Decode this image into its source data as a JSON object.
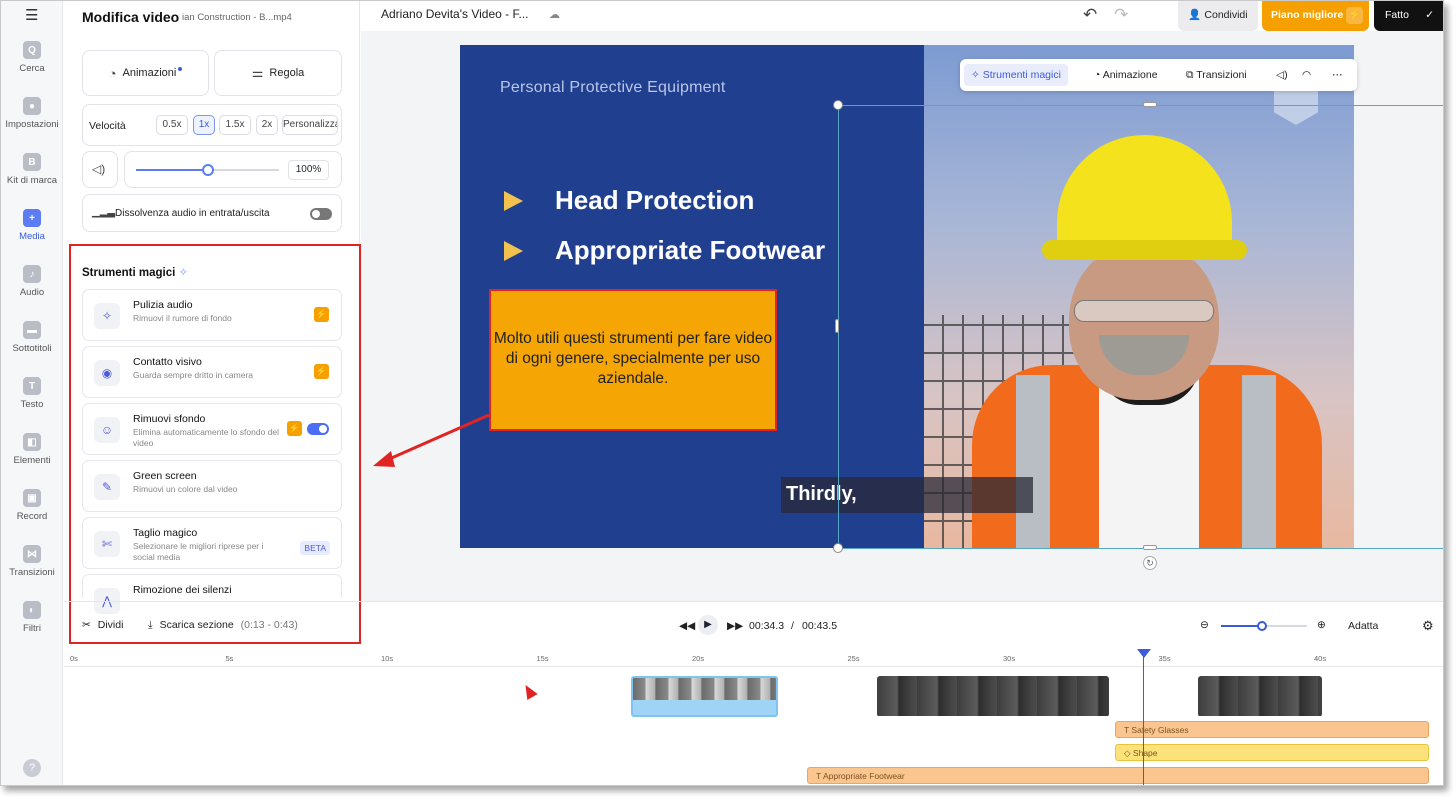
{
  "sidebar": {
    "menu_icon": "hamburger-icon",
    "items": [
      {
        "label": "Cerca",
        "icon": "search-icon",
        "glyph": "Q"
      },
      {
        "label": "Impostazioni",
        "icon": "settings-icon",
        "glyph": "●"
      },
      {
        "label": "Kit di marca",
        "icon": "brand-kit-icon",
        "glyph": "B"
      },
      {
        "label": "Media",
        "icon": "media-plus-icon",
        "glyph": "+"
      },
      {
        "label": "Audio",
        "icon": "music-icon",
        "glyph": "♪"
      },
      {
        "label": "Sottotitoli",
        "icon": "subtitles-icon",
        "glyph": "▬"
      },
      {
        "label": "Testo",
        "icon": "text-icon",
        "glyph": "T"
      },
      {
        "label": "Elementi",
        "icon": "elements-icon",
        "glyph": "◧"
      },
      {
        "label": "Record",
        "icon": "record-icon",
        "glyph": "▣"
      },
      {
        "label": "Transizioni",
        "icon": "transitions-icon",
        "glyph": "⋈"
      },
      {
        "label": "Filtri",
        "icon": "filters-icon",
        "glyph": "◐"
      }
    ],
    "help": "?"
  },
  "panel": {
    "title": "Modifica video",
    "file": "ian Construction - B...mp4",
    "animations_label": "Animazioni",
    "adjust_label": "Regola",
    "speed_label": "Velocità",
    "speed_options": [
      "0.5x",
      "1x",
      "1.5x",
      "2x",
      "Personalizza"
    ],
    "speed_selected": "1x",
    "volume_value": "100%",
    "volume_level": 0.5,
    "fade_label": "Dissolvenza audio in entrata/uscita",
    "fade_on": false,
    "magic_title": "Strumenti magici",
    "tools": [
      {
        "name": "Pulizia audio",
        "desc": "Rimuovi il rumore di fondo",
        "icon": "sparkle-icon",
        "premium": true
      },
      {
        "name": "Contatto visivo",
        "desc": "Guarda sempre dritto in camera",
        "icon": "eye-icon",
        "premium": true
      },
      {
        "name": "Rimuovi sfondo",
        "desc": "Elimina automaticamente lo sfondo del video",
        "icon": "person-bg-icon",
        "premium": true,
        "toggle_on": true
      },
      {
        "name": "Green screen",
        "desc": "Rimuovi un colore dal video",
        "icon": "eyedropper-icon"
      },
      {
        "name": "Taglio magico",
        "desc": "Selezionare le migliori riprese per i social media",
        "icon": "magic-cut-icon",
        "badge": "BETA"
      },
      {
        "name": "Rimozione dei silenzi",
        "desc": "",
        "icon": "silence-icon"
      }
    ],
    "split_label": "Dividi",
    "download_label": "Scarica sezione",
    "download_range": "(0:13 - 0:43)"
  },
  "header": {
    "video_title": "Adriano Devita's Video - F...",
    "share_label": "Condividi",
    "plan_label": "Piano migliore",
    "done_label": "Fatto"
  },
  "slide": {
    "heading": "Personal Protective Equipment",
    "bullets": [
      "Head Protection",
      "Appropriate Footwear"
    ],
    "caption": "Thirdly,"
  },
  "floating_toolbar": {
    "magic": "Strumenti magici",
    "animation": "Animazione",
    "transitions": "Transizioni"
  },
  "callout": {
    "text": "Molto utili questi strumenti per fare video di ogni genere, specialmente per uso aziendale."
  },
  "transport": {
    "current": "00:34.3",
    "separator": "/",
    "total": "00:43.5",
    "fit_label": "Adatta"
  },
  "timeline": {
    "ticks": [
      "0s",
      "5s",
      "10s",
      "15s",
      "20s",
      "25s",
      "30s",
      "35s",
      "40s"
    ],
    "tracks": [
      "Safety Glasses",
      "Shape",
      "Appropriate Footwear"
    ]
  },
  "colors": {
    "accent": "#3b5bdb",
    "premium": "#f59f00",
    "highlight_border": "#e02424",
    "slide_bg": "#203f8e"
  }
}
